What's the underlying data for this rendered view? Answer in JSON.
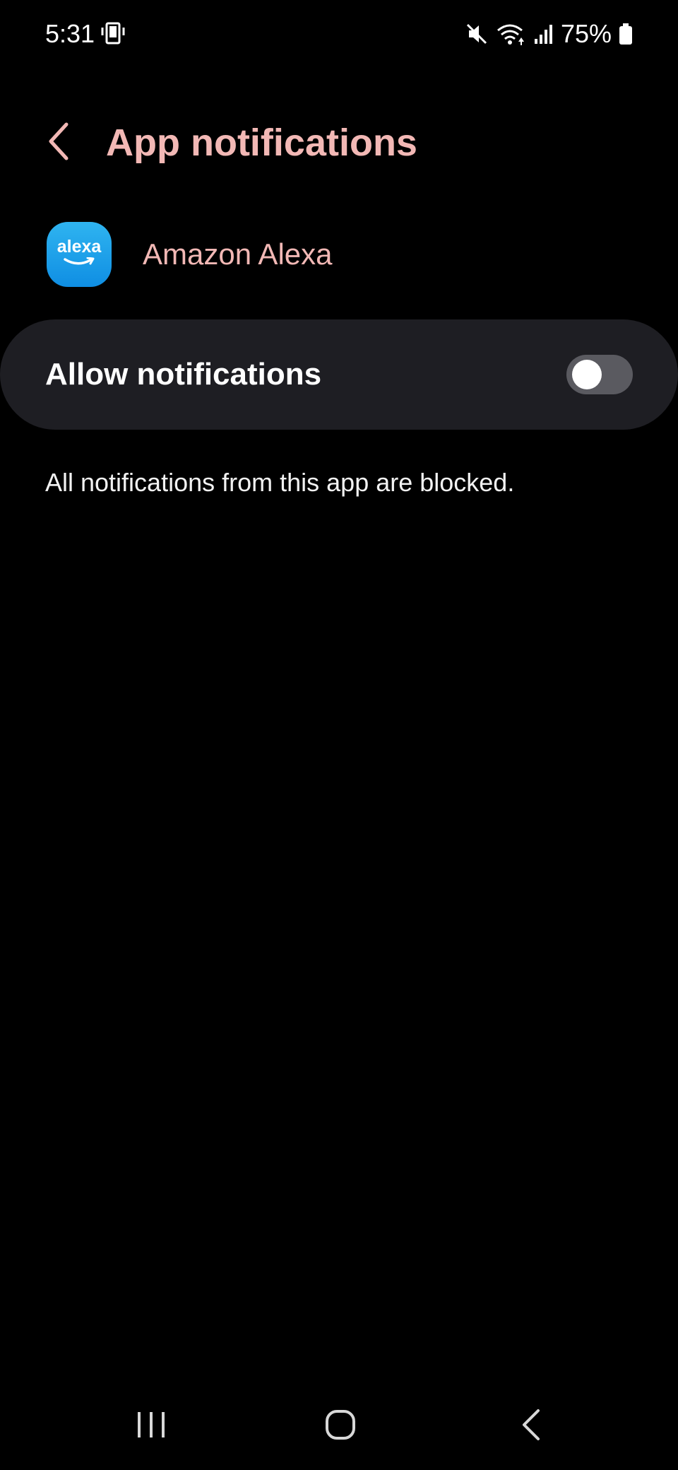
{
  "status_bar": {
    "time": "5:31",
    "battery_text": "75%",
    "icons": [
      "device-icon",
      "mute-icon",
      "wifi-icon",
      "signal-icon",
      "battery-icon"
    ]
  },
  "header": {
    "title": "App notifications",
    "back_icon": "chevron-left-icon"
  },
  "app": {
    "name": "Amazon Alexa",
    "icon_wordmark": "alexa",
    "icon_colors": [
      "#2fb4f0",
      "#0f8ee3"
    ]
  },
  "allow_notifications": {
    "label": "Allow notifications",
    "enabled": false
  },
  "message": "All notifications from this app are blocked.",
  "nav_bar": {
    "buttons": [
      "recents-icon",
      "home-icon",
      "back-icon"
    ]
  },
  "colors": {
    "background": "#000000",
    "accent": "#f2b8b5",
    "card": "#1e1e23",
    "toggle_off_track": "#5a5a60"
  }
}
